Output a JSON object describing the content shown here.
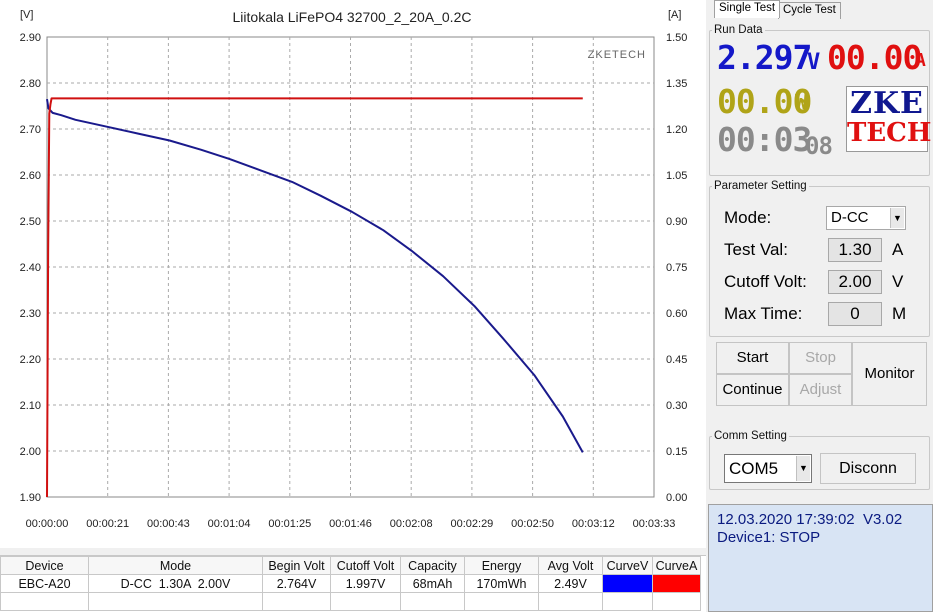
{
  "chart_data": {
    "type": "line",
    "title": "Liitokala LiFePO4 32700_2_20A_0.2C",
    "watermark": "ZKETECH",
    "left_axis_unit": "[V]",
    "right_axis_unit": "[A]",
    "y_left_range": [
      1.9,
      2.9
    ],
    "y_right_range": [
      0.0,
      1.5
    ],
    "x_range_seconds": [
      0,
      213
    ],
    "grid": true,
    "y_left_ticks": [
      "2.90",
      "2.80",
      "2.70",
      "2.60",
      "2.50",
      "2.40",
      "2.30",
      "2.20",
      "2.10",
      "2.00",
      "1.90"
    ],
    "y_right_ticks": [
      "1.50",
      "1.35",
      "1.20",
      "1.05",
      "0.90",
      "0.75",
      "0.60",
      "0.45",
      "0.30",
      "0.15",
      "0.00"
    ],
    "x_ticks": [
      "00:00:00",
      "00:00:21",
      "00:00:43",
      "00:01:04",
      "00:01:25",
      "00:01:46",
      "00:02:08",
      "00:02:29",
      "00:02:50",
      "00:03:12",
      "00:03:33"
    ],
    "series": [
      {
        "axis": "left",
        "color": "#1a1a8c",
        "x": [
          0,
          0.5,
          2,
          5,
          10,
          21,
          32,
          43,
          54,
          64,
          75,
          86,
          96,
          107,
          118,
          128,
          139,
          150,
          160,
          171,
          181,
          188
        ],
        "y": [
          2.765,
          2.745,
          2.735,
          2.73,
          2.72,
          2.705,
          2.69,
          2.675,
          2.655,
          2.635,
          2.61,
          2.585,
          2.555,
          2.52,
          2.48,
          2.435,
          2.38,
          2.315,
          2.245,
          2.165,
          2.075,
          1.997
        ]
      },
      {
        "axis": "right",
        "color": "#d01010",
        "x": [
          0,
          0.4,
          0.8,
          1.2,
          1.6,
          2,
          188
        ],
        "y": [
          0.0,
          0.8,
          1.25,
          1.28,
          1.3,
          1.3,
          1.3
        ]
      }
    ]
  },
  "results_table": {
    "headers": [
      "Device",
      "Mode",
      "Begin Volt",
      "Cutoff Volt",
      "Capacity",
      "Energy",
      "Avg Volt",
      "CurveV",
      "CurveA"
    ],
    "row": [
      "EBC-A20",
      "D-CC  1.30A  2.00V",
      "2.764V",
      "1.997V",
      "68mAh",
      "170mWh",
      "2.49V"
    ],
    "curve_colors": [
      "#0000ff",
      "#ff0000"
    ]
  },
  "tabs": {
    "single": "Single Test",
    "cycle": "Cycle Test"
  },
  "run_data": {
    "legend": "Run Data",
    "volt": "2.297",
    "volt_unit": "V",
    "amp": "00.00",
    "amp_unit": "A",
    "watt": "00.00",
    "watt_unit": "W",
    "time": "00:03",
    "time_sec": "08",
    "logo_top": "ZKE",
    "logo_bottom": "TECH"
  },
  "params": {
    "legend": "Parameter Setting",
    "mode_label": "Mode:",
    "mode_value": "D-CC",
    "test_label": "Test Val:",
    "test_value": "1.30",
    "test_unit": "A",
    "cutoff_label": "Cutoff Volt:",
    "cutoff_value": "2.00",
    "cutoff_unit": "V",
    "max_label": "Max Time:",
    "max_value": "0",
    "max_unit": "M"
  },
  "buttons": {
    "start": "Start",
    "stop": "Stop",
    "continue": "Continue",
    "adjust": "Adjust",
    "monitor": "Monitor"
  },
  "comm": {
    "legend": "Comm Setting",
    "port": "COM5",
    "disconnect": "Disconn"
  },
  "status": {
    "line1": "12.03.2020 17:39:02  V3.02",
    "line2": "Device1: STOP"
  },
  "colors": {
    "voltage_curve": "#1a1a8c",
    "current_curve": "#d01010",
    "volt_lcd": "#1418c8",
    "amp_lcd": "#e01010",
    "watt_lcd": "#b0a418",
    "time_lcd": "#8a8a8a"
  }
}
